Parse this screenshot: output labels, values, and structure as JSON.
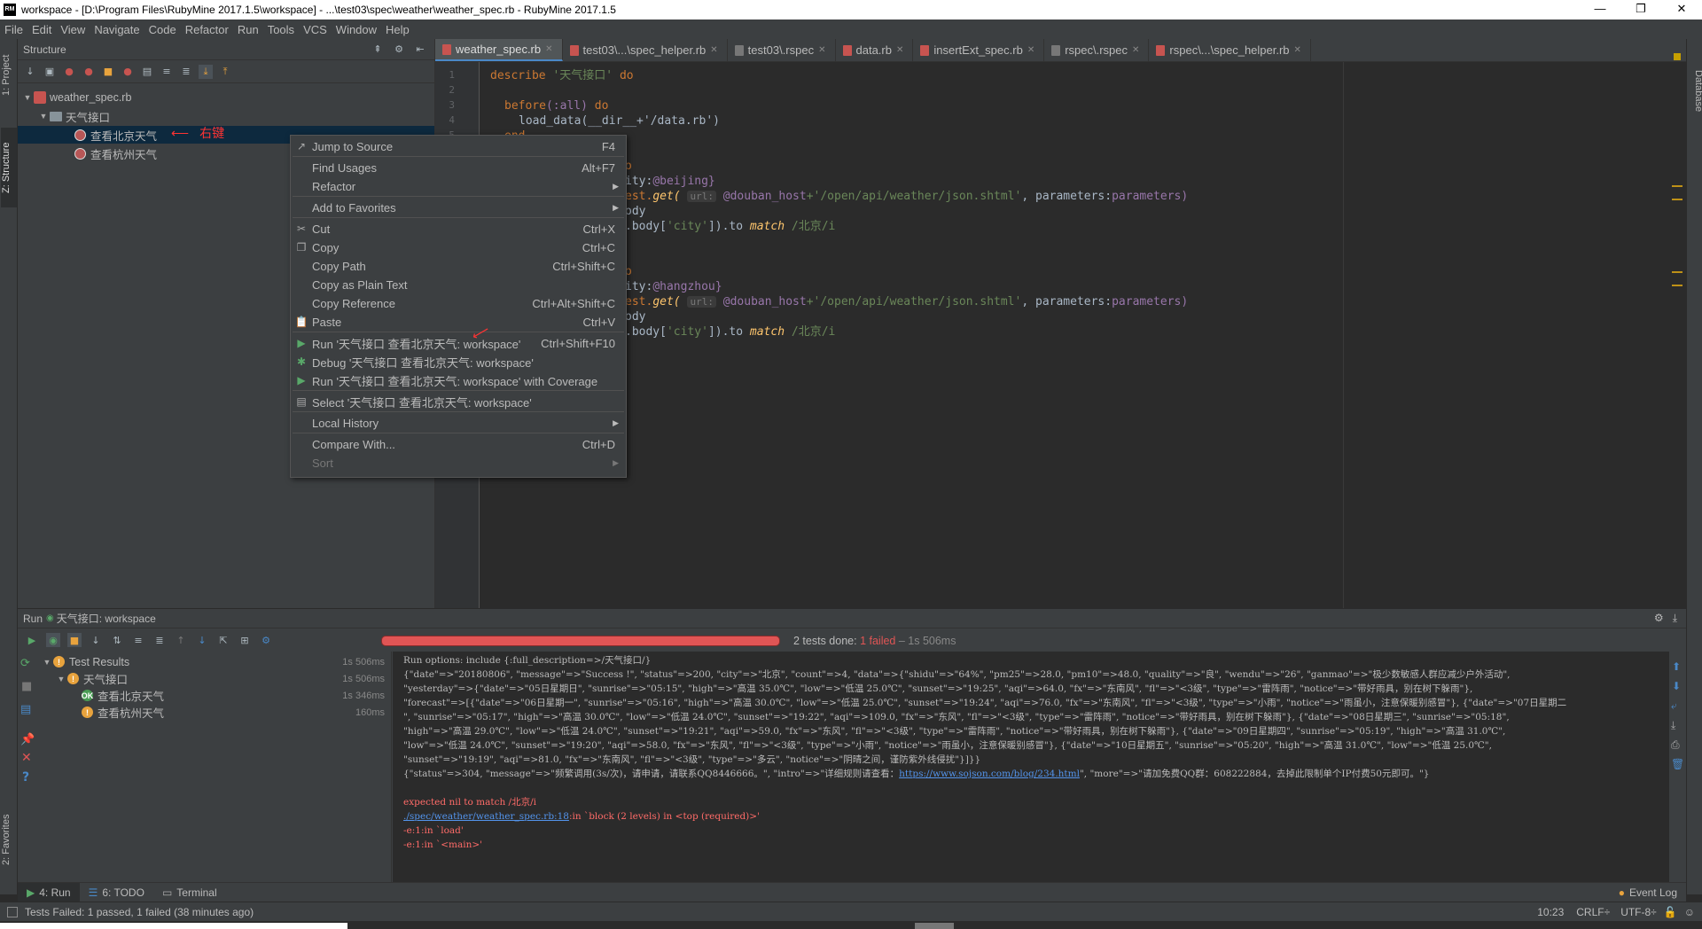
{
  "window": {
    "title": "workspace - [D:\\Program Files\\RubyMine 2017.1.5\\workspace] - ...\\test03\\spec\\weather\\weather_spec.rb - RubyMine 2017.1.5",
    "app_icon": "RM",
    "controls": {
      "minimize": "—",
      "maximize": "❐",
      "close": "✕"
    }
  },
  "menubar": [
    "File",
    "Edit",
    "View",
    "Navigate",
    "Code",
    "Refactor",
    "Run",
    "Tools",
    "VCS",
    "Window",
    "Help"
  ],
  "left_strip": {
    "project": "1: Project",
    "structure": "Z: Structure",
    "favorites": "2: Favorites"
  },
  "right_strip": {
    "database": "Database"
  },
  "structure_panel": {
    "title": "Structure",
    "tree": [
      {
        "label": "weather_spec.rb",
        "level": 0,
        "icon": "ruby-file-icon"
      },
      {
        "label": "天气接口",
        "level": 1,
        "icon": "folder-icon"
      },
      {
        "label": "查看北京天气",
        "level": 2,
        "icon": "spec-icon",
        "selected": true
      },
      {
        "label": "查看杭州天气",
        "level": 2,
        "icon": "spec-icon"
      }
    ],
    "annotation": "右键"
  },
  "editor": {
    "tabs": [
      {
        "label": "weather_spec.rb",
        "active": true
      },
      {
        "label": "test03\\...\\spec_helper.rb"
      },
      {
        "label": "test03\\.rspec"
      },
      {
        "label": "data.rb"
      },
      {
        "label": "insertExt_spec.rb"
      },
      {
        "label": "rspec\\.rspec"
      },
      {
        "label": "rspec\\...\\spec_helper.rb"
      }
    ],
    "line_numbers": [
      "1",
      "2",
      "3",
      "4",
      "5"
    ],
    "code": {
      "l1_kw": "describe",
      "l1_str": "'天气接口'",
      "l1_do": "do",
      "l3_kw": "before",
      "l3_sym": "(:all)",
      "l3_do": "do",
      "l4": "load_data(__dir__+'/data.rb')",
      "l5": "end",
      "l7": "o",
      "l8_a": "ity:",
      "l8_b": "@beijing}",
      "l9_a": "est.",
      "l9_b": "get(",
      "l9_hint": "url:",
      "l9_c": "@douban_host",
      "l9_d": "+'/open/api/weather/json.shtml'",
      "l9_e": ", parameters:",
      "l9_f": "parameters)",
      "l10": "ody",
      "l11_a": ".body[",
      "l11_b": "'city'",
      "l11_c": "]).to ",
      "l11_d": "match",
      "l11_e": " /北京/i",
      "l13": "o",
      "l14_a": "ity:",
      "l14_b": "@hangzhou}",
      "l15_a": "est.",
      "l15_b": "get(",
      "l15_hint": "url:",
      "l15_c": "@douban_host",
      "l15_d": "+'/open/api/weather/json.shtml'",
      "l15_e": ", parameters:",
      "l15_f": "parameters)",
      "l16": "ody",
      "l17_a": ".body[",
      "l17_b": "'city'",
      "l17_c": "]).to ",
      "l17_d": "match",
      "l17_e": " /北京/i"
    }
  },
  "context_menu": {
    "items": [
      {
        "label": "Jump to Source",
        "shortcut": "F4",
        "icon": "jump-icon"
      },
      {
        "label": "Find Usages",
        "shortcut": "Alt+F7"
      },
      {
        "label": "Refactor",
        "submenu": true
      },
      {
        "label": "Add to Favorites",
        "submenu": true
      },
      {
        "label": "Cut",
        "shortcut": "Ctrl+X",
        "icon": "cut-icon"
      },
      {
        "label": "Copy",
        "shortcut": "Ctrl+C",
        "icon": "copy-icon"
      },
      {
        "label": "Copy Path",
        "shortcut": "Ctrl+Shift+C"
      },
      {
        "label": "Copy as Plain Text",
        "shortcut": ""
      },
      {
        "label": "Copy Reference",
        "shortcut": "Ctrl+Alt+Shift+C"
      },
      {
        "label": "Paste",
        "shortcut": "Ctrl+V",
        "icon": "paste-icon"
      },
      {
        "label": "Run '天气接口 查看北京天气: workspace'",
        "shortcut": "Ctrl+Shift+F10",
        "icon": "run-icon"
      },
      {
        "label": "Debug '天气接口 查看北京天气: workspace'",
        "icon": "debug-icon"
      },
      {
        "label": "Run '天气接口 查看北京天气: workspace' with Coverage",
        "icon": "coverage-icon"
      },
      {
        "label": "Select '天气接口 查看北京天气: workspace'",
        "icon": "select-icon"
      },
      {
        "label": "Local History",
        "submenu": true
      },
      {
        "label": "Compare With...",
        "shortcut": "Ctrl+D"
      },
      {
        "label": "Sort",
        "submenu": true,
        "disabled": true
      }
    ]
  },
  "run_panel": {
    "title": "Run",
    "config": "天气接口: workspace",
    "summary_prefix": "2 tests done: ",
    "summary_failed": "1 failed",
    "summary_suffix": " – 1s 506ms",
    "tree": [
      {
        "label": "Test Results",
        "time": "1s 506ms",
        "status": "warn"
      },
      {
        "label": "天气接口",
        "time": "1s 506ms",
        "status": "warn"
      },
      {
        "label": "查看北京天气",
        "time": "1s 346ms",
        "status": "ok"
      },
      {
        "label": "查看杭州天气",
        "time": "160ms",
        "status": "warn"
      }
    ],
    "console": [
      "Run options: include {:full_description=>/天气接口/}",
      "{\"date\"=>\"20180806\", \"message\"=>\"Success !\", \"status\"=>200, \"city\"=>\"北京\", \"count\"=>4, \"data\"=>{\"shidu\"=>\"64%\", \"pm25\"=>28.0, \"pm10\"=>48.0, \"quality\"=>\"良\", \"wendu\"=>\"26\", \"ganmao\"=>\"极少数敏感人群应减少户外活动\",",
      "  \"yesterday\"=>{\"date\"=>\"05日星期日\", \"sunrise\"=>\"05:15\", \"high\"=>\"高温 35.0℃\", \"low\"=>\"低温 25.0℃\", \"sunset\"=>\"19:25\", \"aqi\"=>64.0, \"fx\"=>\"东南风\", \"fl\"=>\"<3级\", \"type\"=>\"雷阵雨\", \"notice\"=>\"带好雨具，别在树下躲雨\"},",
      "  \"forecast\"=>[{\"date\"=>\"06日星期一\", \"sunrise\"=>\"05:16\", \"high\"=>\"高温 30.0℃\", \"low\"=>\"低温 25.0℃\", \"sunset\"=>\"19:24\", \"aqi\"=>76.0, \"fx\"=>\"东南风\", \"fl\"=>\"<3级\", \"type\"=>\"小雨\", \"notice\"=>\"雨虽小，注意保暖别感冒\"}, {\"date\"=>\"07日星期二",
      "  \", \"sunrise\"=>\"05:17\", \"high\"=>\"高温 30.0℃\", \"low\"=>\"低温 24.0℃\", \"sunset\"=>\"19:22\", \"aqi\"=>109.0, \"fx\"=>\"东风\", \"fl\"=>\"<3级\", \"type\"=>\"雷阵雨\", \"notice\"=>\"带好雨具，别在树下躲雨\"}, {\"date\"=>\"08日星期三\", \"sunrise\"=>\"05:18\",",
      "  \"high\"=>\"高温 29.0℃\", \"low\"=>\"低温 24.0℃\", \"sunset\"=>\"19:21\", \"aqi\"=>59.0, \"fx\"=>\"东风\", \"fl\"=>\"<3级\", \"type\"=>\"雷阵雨\", \"notice\"=>\"带好雨具，别在树下躲雨\"}, {\"date\"=>\"09日星期四\", \"sunrise\"=>\"05:19\", \"high\"=>\"高温 31.0℃\",",
      "  \"low\"=>\"低温 24.0℃\", \"sunset\"=>\"19:20\", \"aqi\"=>58.0, \"fx\"=>\"东风\", \"fl\"=>\"<3级\", \"type\"=>\"小雨\", \"notice\"=>\"雨虽小，注意保暖别感冒\"}, {\"date\"=>\"10日星期五\", \"sunrise\"=>\"05:20\", \"high\"=>\"高温 31.0℃\", \"low\"=>\"低温 25.0℃\",",
      "  \"sunset\"=>\"19:19\", \"aqi\"=>81.0, \"fx\"=>\"东南风\", \"fl\"=>\"<3级\", \"type\"=>\"多云\", \"notice\"=>\"阴晴之间，谨防紫外线侵扰\"}]}}"
    ],
    "console_status_line_a": "{\"status\"=>304, \"message\"=>\"频繁调用(3s/次)，请申请，请联系QQ8446666。\", \"intro\"=>\"详细规则请查看：",
    "console_status_link": "https://www.sojson.com/blog/234.html",
    "console_status_line_b": "\", \"more\"=>\"请加免费QQ群：608222884，去掉此限制单个IP付费50元即可。\"}",
    "console_err": "expected nil to match /北京/i",
    "console_trace_link": "./spec/weather/weather_spec.rb:18",
    "console_trace_rest": ":in `block (2 levels) in <top (required)>'",
    "console_trace2": "-e:1:in `load'",
    "console_trace3": "-e:1:in `<main>'"
  },
  "bottom_tabs": [
    {
      "label": "4: Run",
      "active": true
    },
    {
      "label": "6: TODO"
    },
    {
      "label": "Terminal"
    }
  ],
  "event_log": "Event Log",
  "status_bar": {
    "message": "Tests Failed: 1 passed, 1 failed (38 minutes ago)",
    "position": "10:23",
    "line_sep": "CRLF÷",
    "encoding": "UTF-8÷"
  },
  "colors": {
    "accent": "#4a88c7",
    "error": "#e05555",
    "warning": "#e8a33d",
    "success": "#499c54"
  }
}
